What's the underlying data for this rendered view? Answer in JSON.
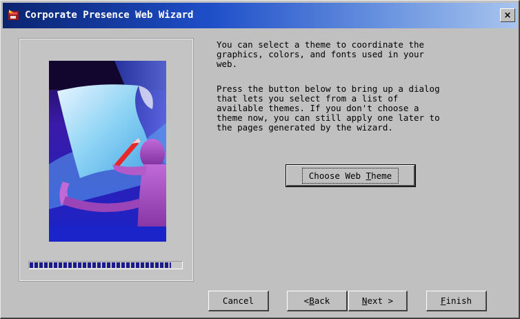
{
  "window": {
    "title": "Corporate Presence Web Wizard",
    "close_glyph": "×",
    "app_icon": "frontpage-wizard-icon"
  },
  "intro": {
    "paragraph1": "You can select a theme to coordinate the\ngraphics, colors, and fonts used in your\nweb.",
    "paragraph2": "Press the button below to bring up a dialog\nthat lets you select from a list of\navailable themes. If you don't choose a\ntheme now, you can still apply one later to\nthe pages generated by the wizard."
  },
  "theme_button": {
    "before": "Choose Web ",
    "accel": "T",
    "after": "heme"
  },
  "progress": {
    "fraction": 0.93
  },
  "buttons": {
    "cancel": "Cancel",
    "back": {
      "before": "< ",
      "accel": "B",
      "after": "ack"
    },
    "next": {
      "accel": "N",
      "after": "ext >"
    },
    "finish": {
      "accel": "F",
      "after": "inish"
    }
  },
  "colors": {
    "titlebar_start": "#0a2470",
    "titlebar_end": "#a8c4ee",
    "dialog_face": "#c0c0c0",
    "progress_fill": "#1a1a8c"
  }
}
